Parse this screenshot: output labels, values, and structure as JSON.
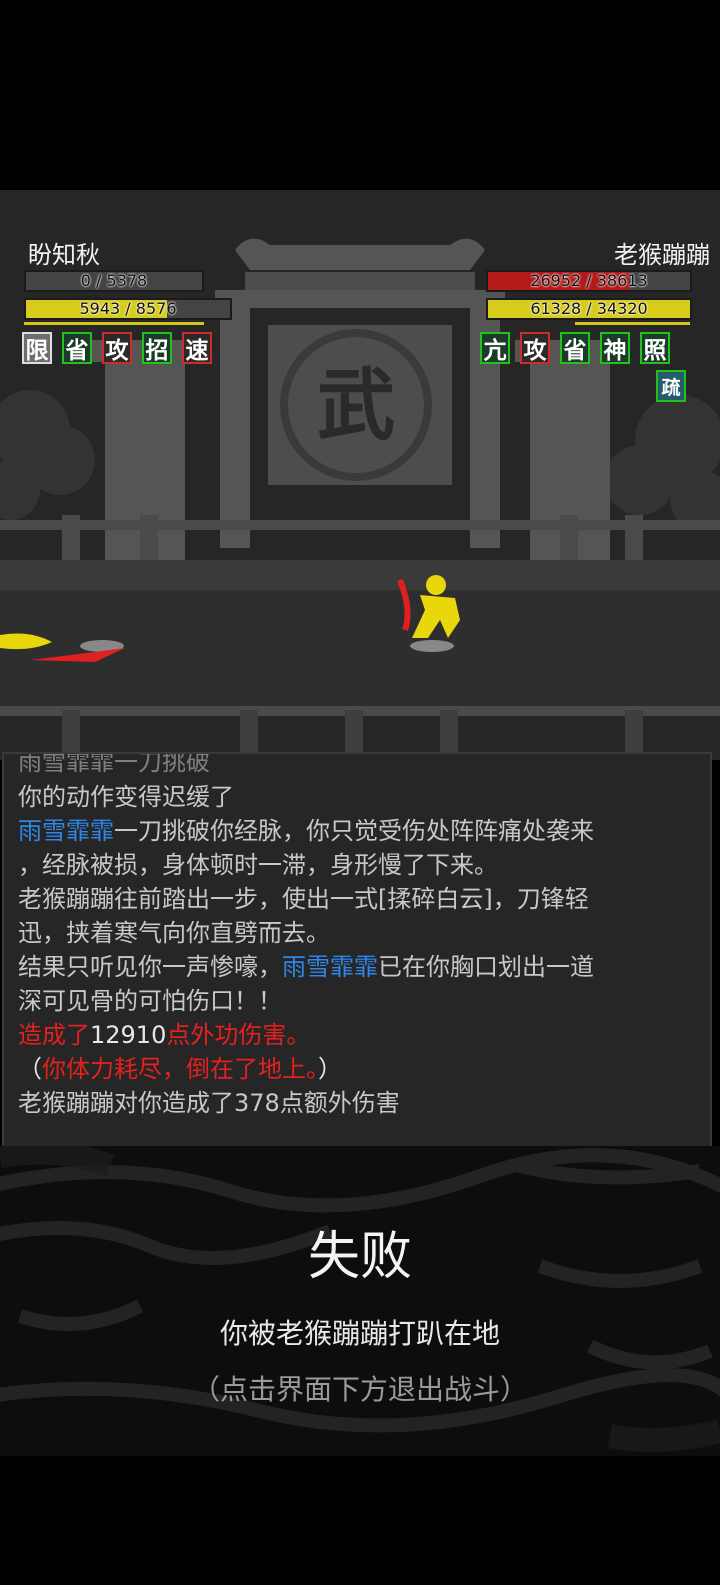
{
  "player": {
    "name": "盼知秋",
    "hp_text": "0 / 5378",
    "mp_text": "5943 / 8576",
    "hp_ratio": 0.0,
    "mp_ratio": 0.693,
    "statuses": [
      {
        "label": "限",
        "style": "gray"
      },
      {
        "label": "省",
        "style": "green"
      },
      {
        "label": "攻",
        "style": "red"
      },
      {
        "label": "招",
        "style": "green"
      },
      {
        "label": "速",
        "style": "red"
      }
    ]
  },
  "enemy": {
    "name": "老猴蹦蹦",
    "hp_text": "26952 / 38613",
    "mp_text": "61328 / 34320",
    "hp_ratio": 0.698,
    "mp_ratio": 1.0,
    "statuses": [
      {
        "label": "亢",
        "style": "green"
      },
      {
        "label": "攻",
        "style": "red"
      },
      {
        "label": "省",
        "style": "green"
      },
      {
        "label": "神",
        "style": "green"
      },
      {
        "label": "照",
        "style": "green"
      }
    ],
    "status_extra": {
      "label": "疏",
      "style": "lightgreen"
    }
  },
  "scene": {
    "sign_char": "武"
  },
  "log": {
    "partial_line": "雨雪霏霏一刀挑破",
    "lines": [
      [
        {
          "t": "你的动作变得迟缓了",
          "c": ""
        }
      ],
      [
        {
          "t": "雨雪霏霏",
          "c": "blue"
        },
        {
          "t": "一刀挑破你经脉，你只觉受伤处阵阵痛处袭来",
          "c": ""
        }
      ],
      [
        {
          "t": "，经脉被损，身体顿时一滞，身形慢了下来。",
          "c": ""
        }
      ],
      [
        {
          "t": "老猴蹦蹦往前踏出一步，使出一式[揉碎白云]，刀锋轻",
          "c": ""
        }
      ],
      [
        {
          "t": "迅，挟着寒气向你直劈而去。",
          "c": ""
        }
      ],
      [
        {
          "t": "结果只听见你一声惨嚎，",
          "c": ""
        },
        {
          "t": "雨雪霏霏",
          "c": "blue"
        },
        {
          "t": "已在你胸口划出一道",
          "c": ""
        }
      ],
      [
        {
          "t": "深可见骨的可怕伤口！！",
          "c": ""
        }
      ],
      [
        {
          "t": "造成了",
          "c": "red"
        },
        {
          "t": "12910",
          "c": "wht"
        },
        {
          "t": "点外功伤害。",
          "c": "red"
        }
      ],
      [
        {
          "t": "（",
          "c": "wht"
        },
        {
          "t": "你体力耗尽，倒在了地上。",
          "c": "red"
        },
        {
          "t": "）",
          "c": "wht"
        }
      ],
      [
        {
          "t": "老猴蹦蹦对你造成了378点额外伤害",
          "c": ""
        }
      ]
    ]
  },
  "result": {
    "title": "失败",
    "message": "你被老猴蹦蹦打趴在地",
    "hint": "（点击界面下方退出战斗）"
  }
}
